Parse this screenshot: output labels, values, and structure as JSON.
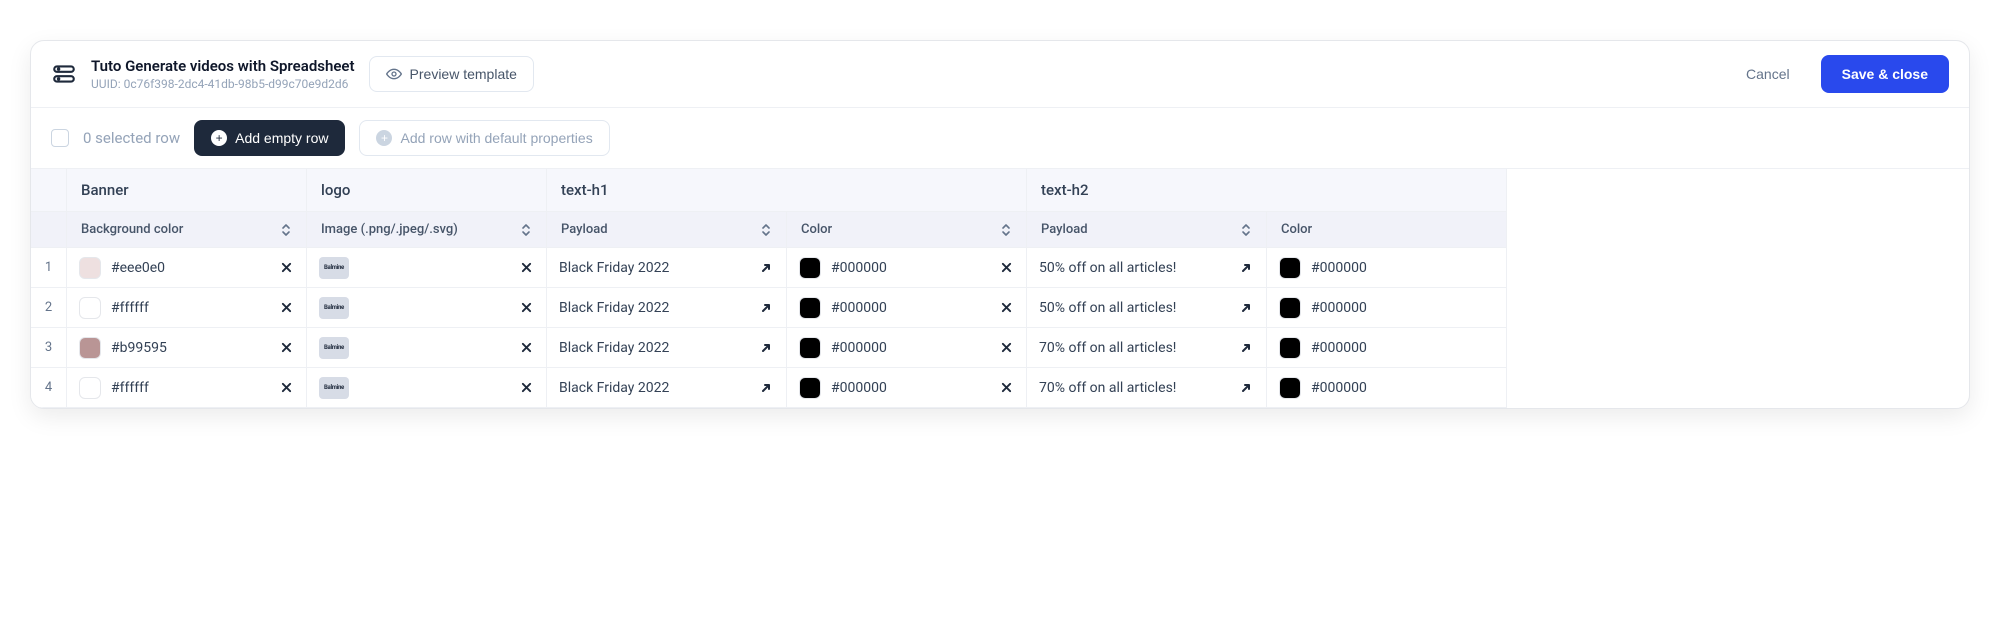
{
  "header": {
    "title": "Tuto Generate videos with Spreadsheet",
    "uuid_label": "UUID: 0c76f398-2dc4-41db-98b5-d99c70e9d2d6",
    "preview_label": "Preview template",
    "cancel_label": "Cancel",
    "save_label": "Save & close"
  },
  "subheader": {
    "selected_text": "0 selected row",
    "add_empty_label": "Add empty row",
    "add_default_label": "Add row with default properties"
  },
  "columns": {
    "banner": {
      "group": "Banner",
      "sub": "Background color"
    },
    "logo": {
      "group": "logo",
      "sub": "Image (.png/.jpeg/.svg)"
    },
    "h1_payload": {
      "group": "text-h1",
      "sub": "Payload"
    },
    "h1_color": {
      "sub": "Color"
    },
    "h2_payload": {
      "group": "text-h2",
      "sub": "Payload"
    },
    "h2_color": {
      "sub": "Color"
    }
  },
  "thumb_text": "Balmine",
  "rows": [
    {
      "n": "1",
      "banner_color": "#eee0e0",
      "h1_payload": "Black Friday 2022",
      "h1_color": "#000000",
      "h2_payload": "50% off on all articles!",
      "h2_color": "#000000"
    },
    {
      "n": "2",
      "banner_color": "#ffffff",
      "h1_payload": "Black Friday 2022",
      "h1_color": "#000000",
      "h2_payload": "50% off on all articles!",
      "h2_color": "#000000"
    },
    {
      "n": "3",
      "banner_color": "#b99595",
      "h1_payload": "Black Friday 2022",
      "h1_color": "#000000",
      "h2_payload": "70% off on all articles!",
      "h2_color": "#000000"
    },
    {
      "n": "4",
      "banner_color": "#ffffff",
      "h1_payload": "Black Friday 2022",
      "h1_color": "#000000",
      "h2_payload": "70% off on all articles!",
      "h2_color": "#000000"
    }
  ]
}
